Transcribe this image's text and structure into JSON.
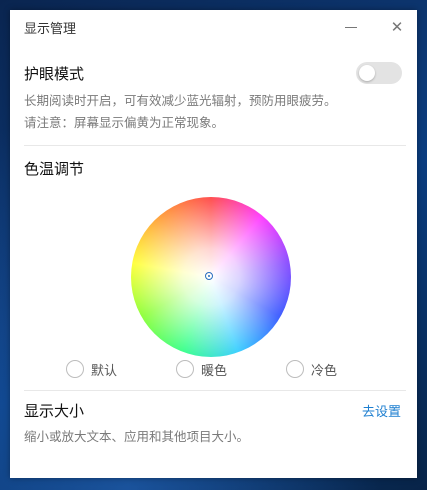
{
  "window": {
    "title": "显示管理",
    "minimize_glyph": "—",
    "close_glyph": "✕"
  },
  "eye_protection": {
    "heading": "护眼模式",
    "description_line1": "长期阅读时开启，可有效减少蓝光辐射，预防用眼疲劳。",
    "description_line2": "请注意：屏幕显示偏黄为正常现象。",
    "toggle_on": false
  },
  "color_temperature": {
    "heading": "色温调节",
    "options": [
      {
        "label": "默认",
        "selected": false
      },
      {
        "label": "暖色",
        "selected": false
      },
      {
        "label": "冷色",
        "selected": false
      }
    ]
  },
  "display_size": {
    "heading": "显示大小",
    "link_label": "去设置",
    "description": "缩小或放大文本、应用和其他项目大小。"
  },
  "colors": {
    "link": "#1e7fd0",
    "marker": "#2a6ec0",
    "toggle_off": "#e3e3e3"
  }
}
